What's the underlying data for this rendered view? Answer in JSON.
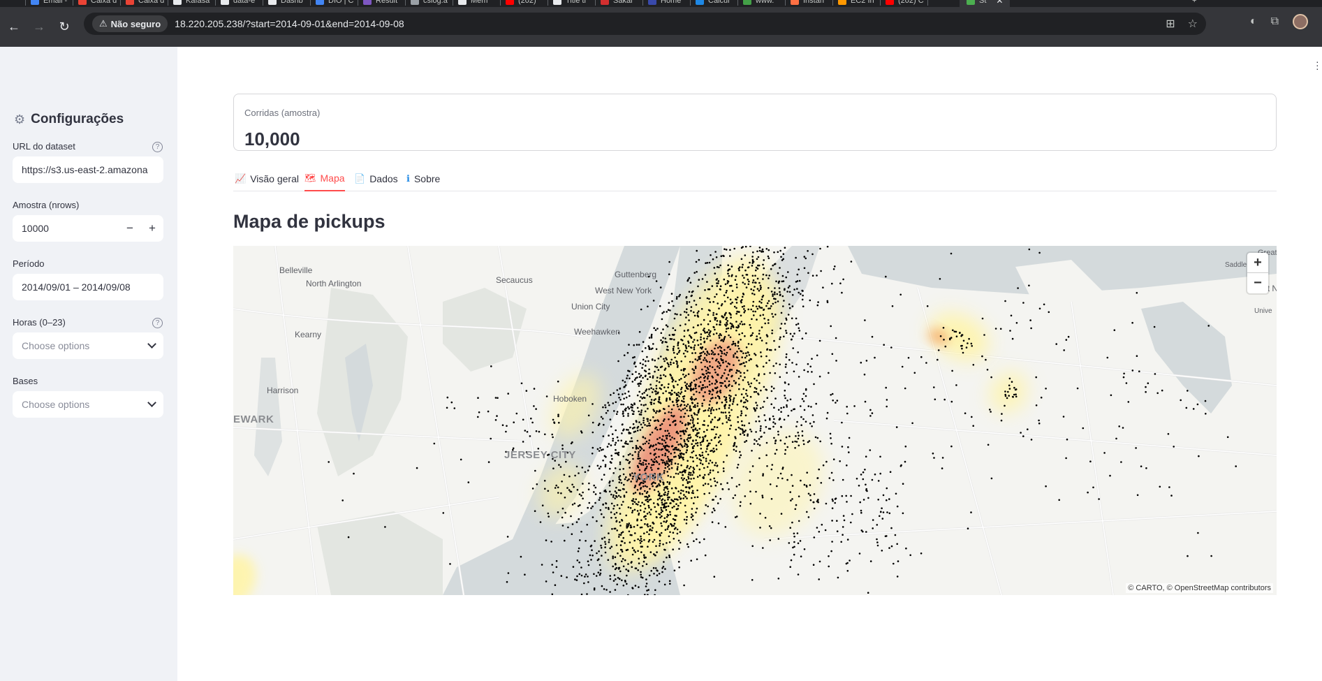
{
  "browser": {
    "tabs": [
      "Email -",
      "Caixa d",
      "Caixa d",
      "Kafasa",
      "data-e",
      "Dashb",
      "DIO | C",
      "Result",
      "csiog.a",
      "Mem",
      "(202)",
      "Title ti",
      "Sakai",
      "Home",
      "Calcul",
      "www.",
      "Instan",
      "EC2 In",
      "(202) C",
      "St"
    ],
    "tab_colors": [
      "#4285f4",
      "#ea4335",
      "#ea4335",
      "#e8eaed",
      "#e8eaed",
      "#e8eaed",
      "#4285f4",
      "#7e57c2",
      "#9aa0a6",
      "#e8eaed",
      "#ff0000",
      "#e8eaed",
      "#d32f2f",
      "#3949ab",
      "#1e88e5",
      "#43a047",
      "#ff7043",
      "#ff9800",
      "#ff0000",
      "#4caf50"
    ],
    "security_label": "Não seguro",
    "url": "18.220.205.238/?start=2014-09-01&end=2014-09-08"
  },
  "sidebar": {
    "title": "Configurações",
    "dataset_url": {
      "label": "URL do dataset",
      "value": "https://s3.us-east-2.amazona"
    },
    "sample": {
      "label": "Amostra (nrows)",
      "value": "10000",
      "minus": "−",
      "plus": "+"
    },
    "period": {
      "label": "Período",
      "value": "2014/09/01 – 2014/09/08"
    },
    "hours": {
      "label": "Horas (0–23)",
      "placeholder": "Choose options"
    },
    "bases": {
      "label": "Bases",
      "placeholder": "Choose options"
    }
  },
  "main": {
    "metric": {
      "label": "Corridas (amostra)",
      "value": "10,000"
    },
    "tabs": [
      {
        "icon": "📈",
        "label": "Visão geral"
      },
      {
        "icon": "🗺",
        "label": "Mapa"
      },
      {
        "icon": "📄",
        "label": "Dados"
      },
      {
        "icon": "ℹ",
        "label": "Sobre"
      }
    ],
    "active_tab": "Mapa",
    "heading": "Mapa de pickups",
    "map": {
      "attribution": "© CARTO, © OpenStreetMap contributors",
      "zoom_in": "+",
      "zoom_out": "−",
      "places": [
        "Belleville",
        "North Arlington",
        "Secaucus",
        "Guttenberg",
        "West New York",
        "Union City",
        "Weehawken",
        "Kearny",
        "Harrison",
        "Hoboken",
        "JERSEY CITY",
        "EWARK",
        "YORK",
        "Saddle Rock",
        "Great N",
        "Great",
        "Unive"
      ],
      "colors": {
        "water": "#d4dadc",
        "land": "#f4f4f1",
        "park": "#e3e6e1",
        "point": "#000000",
        "heat_low": "#fff4a8",
        "heat_high": "#e0505a"
      }
    }
  }
}
